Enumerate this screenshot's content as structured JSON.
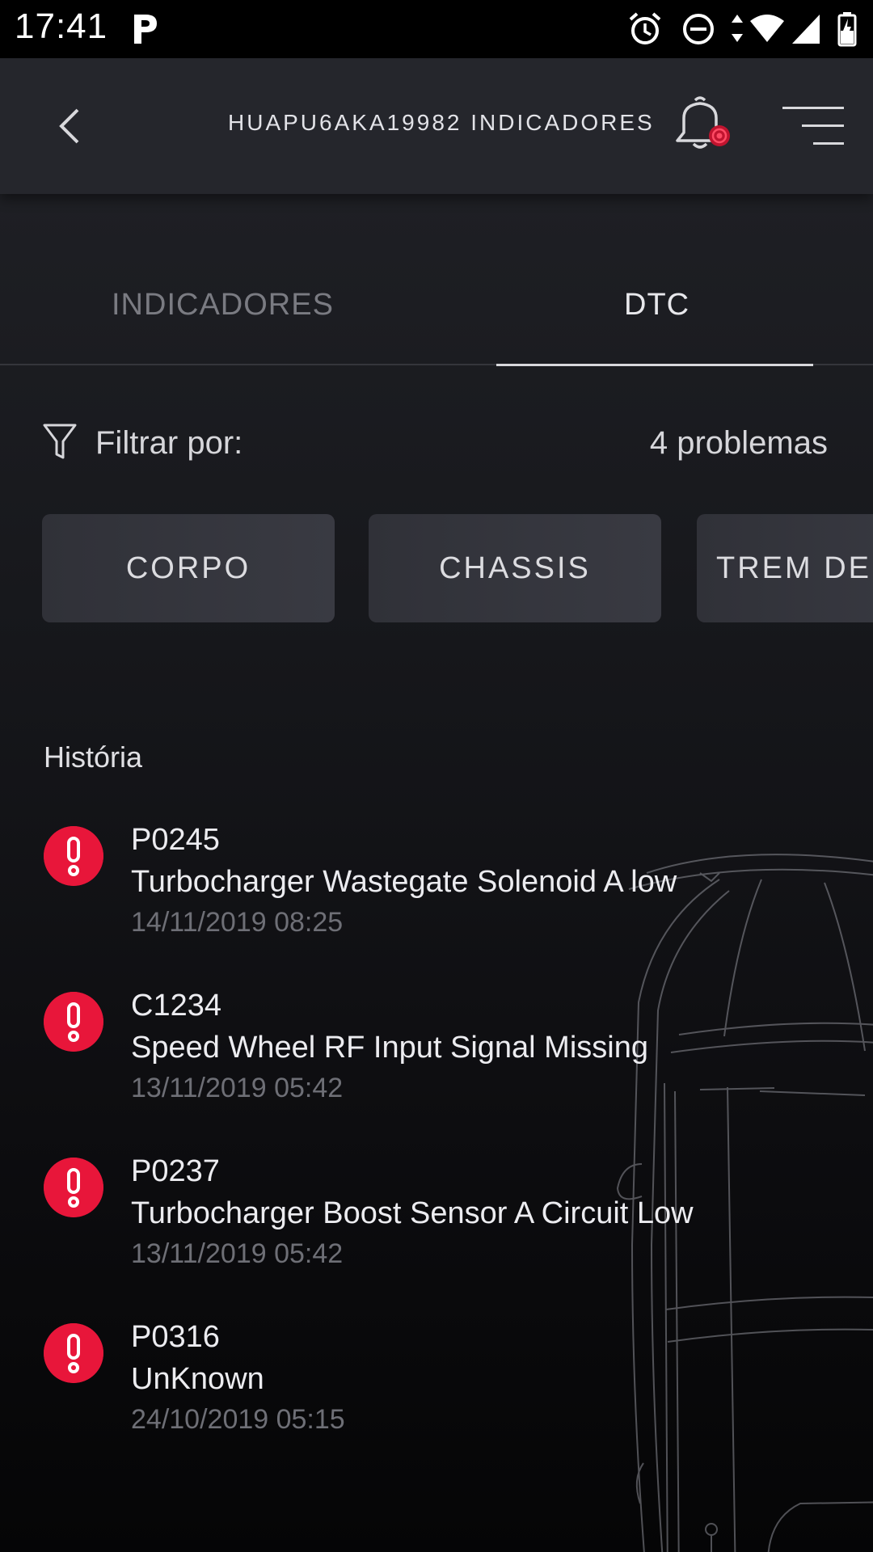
{
  "status_bar": {
    "time": "17:41",
    "icons": [
      "parking-icon",
      "alarm-icon",
      "do-not-disturb-icon",
      "data-arrows-icon",
      "wifi-icon",
      "signal-icon",
      "battery-charging-icon"
    ]
  },
  "header": {
    "title": "HUAPU6AKA19982 INDICADORES",
    "back_icon": "chevron-left-icon",
    "bell_icon": "bell-icon",
    "menu_icon": "menu-icon"
  },
  "tabs": [
    {
      "label": "INDICADORES",
      "active": false
    },
    {
      "label": "DTC",
      "active": true
    }
  ],
  "filter": {
    "label": "Filtrar por:",
    "count": "4 problemas",
    "chips": [
      "CORPO",
      "CHASSIS",
      "TREM DE"
    ]
  },
  "history": {
    "title": "História",
    "items": [
      {
        "code": "P0245",
        "description": "Turbocharger Wastegate Solenoid A low",
        "date": "14/11/2019 08:25"
      },
      {
        "code": "C1234",
        "description": "Speed Wheel RF Input Signal Missing",
        "date": "13/11/2019 05:42"
      },
      {
        "code": "P0237",
        "description": "Turbocharger Boost Sensor A Circuit Low",
        "date": "13/11/2019 05:42"
      },
      {
        "code": "P0316",
        "description": "UnKnown",
        "date": "24/10/2019 05:15"
      }
    ]
  },
  "colors": {
    "alert": "#e8163a",
    "app_bar": "#25262c",
    "chip": "#34353c",
    "muted_text": "#6e6f76"
  }
}
